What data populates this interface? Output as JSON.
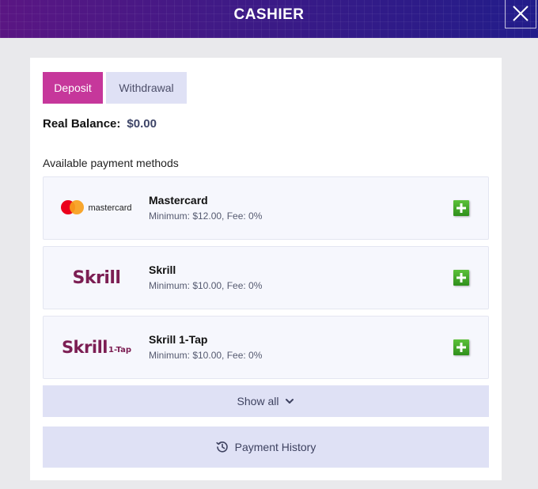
{
  "header": {
    "title": "CASHIER",
    "close_icon": "close-icon"
  },
  "tabs": [
    {
      "label": "Deposit",
      "active": true
    },
    {
      "label": "Withdrawal",
      "active": false
    }
  ],
  "balance": {
    "label": "Real Balance:",
    "value": "$0.00"
  },
  "methods_heading": "Available payment methods",
  "methods": [
    {
      "logo": "mastercard",
      "logo_text": "mastercard",
      "name": "Mastercard",
      "detail": "Minimum: $12.00, Fee: 0%",
      "action_icon": "plus-icon"
    },
    {
      "logo": "skrill",
      "logo_text": "Skrill",
      "name": "Skrill",
      "detail": "Minimum: $10.00, Fee: 0%",
      "action_icon": "plus-icon"
    },
    {
      "logo": "skrill-1-tap",
      "logo_text": "Skrill",
      "logo_sub": "1-Tap",
      "name": "Skrill 1-Tap",
      "detail": "Minimum: $10.00, Fee: 0%",
      "action_icon": "plus-icon"
    }
  ],
  "show_all": {
    "label": "Show all",
    "icon": "chevron-down-icon"
  },
  "payment_history": {
    "label": "Payment History",
    "icon": "history-icon"
  },
  "colors": {
    "header_start": "#5a1683",
    "header_end": "#221c8a",
    "deposit_tab": "#c6379b",
    "secondary_button": "#dfe1f5",
    "add_button": "#3fa52a",
    "skrill_brand": "#7c1e53"
  }
}
